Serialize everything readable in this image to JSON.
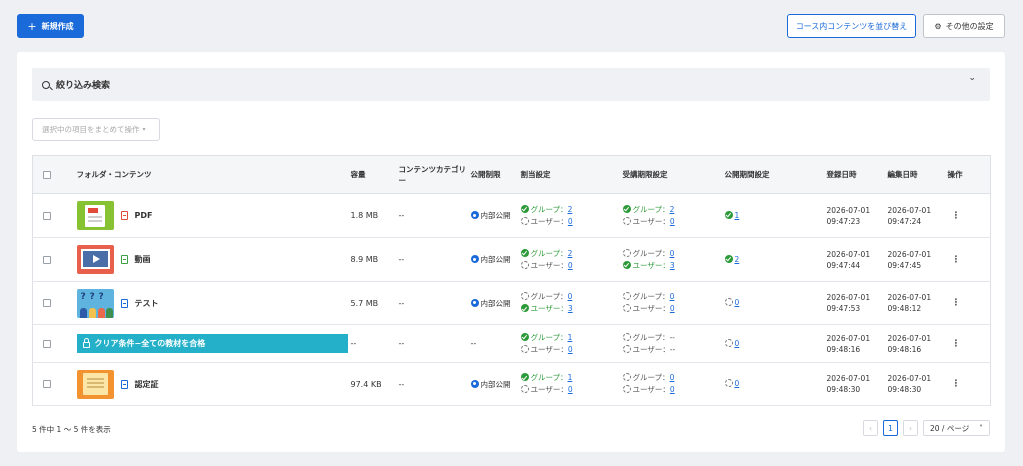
{
  "toolbar": {
    "new_label": "新規作成",
    "sort_label": "コース内コンテンツを並び替え",
    "other_label": "その他の設定"
  },
  "filter": {
    "label": "絞り込み検索"
  },
  "bulk_action": {
    "label": "選択中の項目をまとめて操作"
  },
  "table": {
    "headers": {
      "folder": "フォルダ・コンテンツ",
      "size": "容量",
      "category": "コンテンツカテゴリー",
      "visibility": "公開制限",
      "assignment": "割当設定",
      "enroll_period": "受講期限設定",
      "publish_period": "公開期間設定",
      "created": "登録日時",
      "updated": "編集日時",
      "actions": "操作"
    },
    "rows": [
      {
        "thumb": "pdf-thumbnail",
        "type_icon": "pdf-file-icon",
        "name": "PDF",
        "size": "1.8 MB",
        "category": "--",
        "visibility": "内部公開",
        "assign_group_label": "グループ：",
        "assign_group": "2",
        "assign_user_label": "ユーザー：",
        "assign_user": "0",
        "enroll_group_label": "グループ：",
        "enroll_group": "2",
        "enroll_user_label": "ユーザー：",
        "enroll_user": "0",
        "publish": "1",
        "created_date": "2026-07-01",
        "created_time": "09:47:23",
        "updated_date": "2026-07-01",
        "updated_time": "09:47:24"
      },
      {
        "thumb": "video-thumbnail",
        "type_icon": "video-file-icon",
        "name": "動画",
        "size": "8.9 MB",
        "category": "--",
        "visibility": "内部公開",
        "assign_group_label": "グループ：",
        "assign_group": "2",
        "assign_user_label": "ユーザー：",
        "assign_user": "0",
        "enroll_group_label": "グループ：",
        "enroll_group": "0",
        "enroll_user_label": "ユーザー：",
        "enroll_user": "3",
        "publish": "2",
        "created_date": "2026-07-01",
        "created_time": "09:47:44",
        "updated_date": "2026-07-01",
        "updated_time": "09:47:45"
      },
      {
        "thumb": "test-thumbnail",
        "type_icon": "test-file-icon",
        "name": "テスト",
        "size": "5.7 MB",
        "category": "--",
        "visibility": "内部公開",
        "assign_group_label": "グループ：",
        "assign_group": "0",
        "assign_user_label": "ユーザー：",
        "assign_user": "3",
        "enroll_group_label": "グループ：",
        "enroll_group": "0",
        "enroll_user_label": "ユーザー：",
        "enroll_user": "0",
        "publish": "0",
        "created_date": "2026-07-01",
        "created_time": "09:47:53",
        "updated_date": "2026-07-01",
        "updated_time": "09:48:12"
      },
      {
        "gate_label": "クリア条件−全ての教材を合格",
        "size": "--",
        "category": "--",
        "visibility": "--",
        "assign_group_label": "グループ：",
        "assign_group": "1",
        "assign_user_label": "ユーザー：",
        "assign_user": "0",
        "enroll_group_label": "グループ：",
        "enroll_group": "--",
        "enroll_user_label": "ユーザー：",
        "enroll_user": "--",
        "publish": "0",
        "created_date": "2026-07-01",
        "created_time": "09:48:16",
        "updated_date": "2026-07-01",
        "updated_time": "09:48:16"
      },
      {
        "thumb": "certificate-thumbnail",
        "type_icon": "certificate-file-icon",
        "name": "認定証",
        "size": "97.4 KB",
        "category": "--",
        "visibility": "内部公開",
        "assign_group_label": "グループ：",
        "assign_group": "1",
        "assign_user_label": "ユーザー：",
        "assign_user": "0",
        "enroll_group_label": "グループ：",
        "enroll_group": "0",
        "enroll_user_label": "ユーザー：",
        "enroll_user": "0",
        "publish": "0",
        "created_date": "2026-07-01",
        "created_time": "09:48:30",
        "updated_date": "2026-07-01",
        "updated_time": "09:48:30"
      }
    ]
  },
  "pagination": {
    "summary": "5 件中 1 ～ 5 件を表示",
    "prev": "‹",
    "current_page": "1",
    "next": "›",
    "page_size": "20 / ページ"
  },
  "colors": {
    "primary": "#1a6ad9",
    "success": "#2c9a38",
    "gate_bar": "#23b0c8"
  }
}
